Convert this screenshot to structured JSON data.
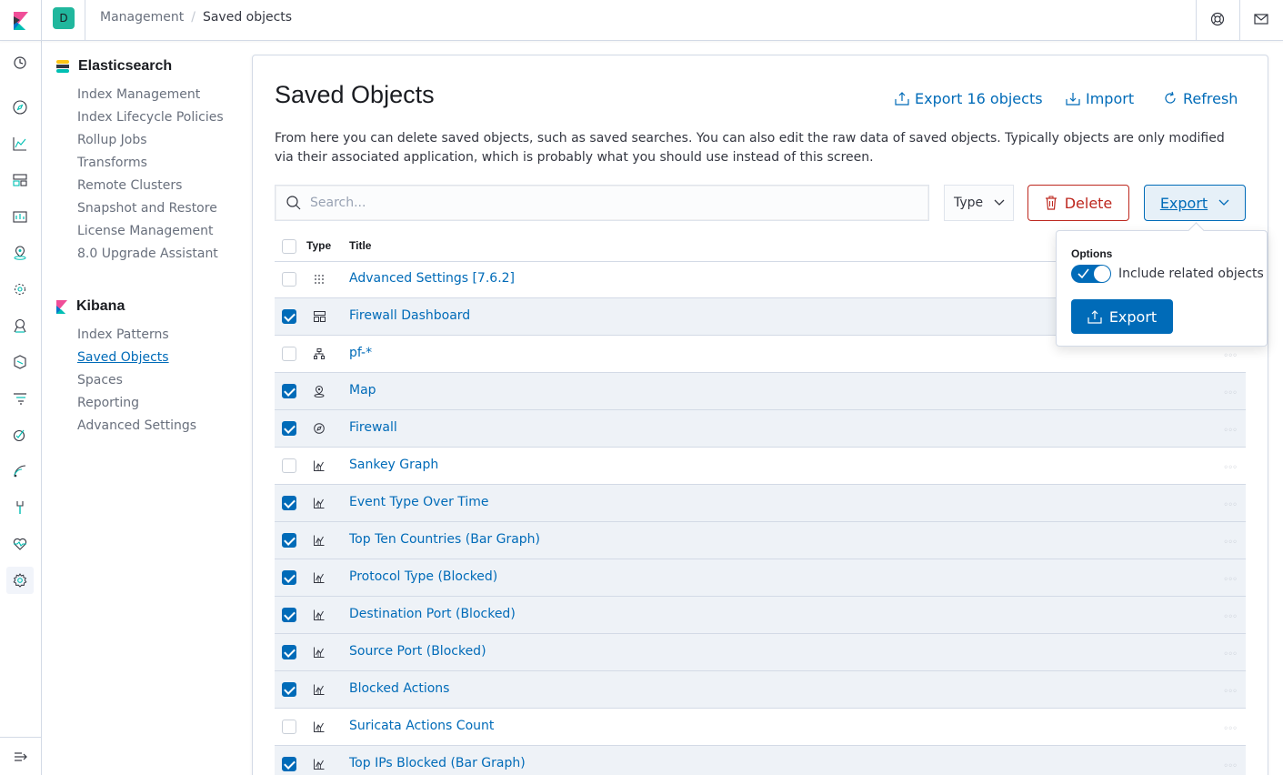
{
  "header": {
    "space_initial": "D",
    "breadcrumbs": [
      "Management",
      "Saved objects"
    ]
  },
  "sidenav": {
    "elasticsearch": {
      "title": "Elasticsearch",
      "items": [
        "Index Management",
        "Index Lifecycle Policies",
        "Rollup Jobs",
        "Transforms",
        "Remote Clusters",
        "Snapshot and Restore",
        "License Management",
        "8.0 Upgrade Assistant"
      ]
    },
    "kibana": {
      "title": "Kibana",
      "items": [
        "Index Patterns",
        "Saved Objects",
        "Spaces",
        "Reporting",
        "Advanced Settings"
      ],
      "selected": "Saved Objects"
    }
  },
  "main": {
    "title": "Saved Objects",
    "export_all_label": "Export 16 objects",
    "import_label": "Import",
    "refresh_label": "Refresh",
    "description": "From here you can delete saved objects, such as saved searches. You can also edit the raw data of saved objects. Typically objects are only modified via their associated application, which is probably what you should use instead of this screen.",
    "search_placeholder": "Search...",
    "type_filter_label": "Type",
    "delete_label": "Delete",
    "export_label": "Export",
    "columns": {
      "type": "Type",
      "title": "Title"
    },
    "rows": [
      {
        "title": "Advanced Settings [7.6.2]",
        "icon": "settings-grid-icon",
        "checked": false
      },
      {
        "title": "Firewall Dashboard",
        "icon": "dashboard-icon",
        "checked": true
      },
      {
        "title": "pf-*",
        "icon": "index-pattern-icon",
        "checked": false
      },
      {
        "title": "Map",
        "icon": "map-icon",
        "checked": true
      },
      {
        "title": "Firewall",
        "icon": "discover-icon",
        "checked": true
      },
      {
        "title": "Sankey Graph",
        "icon": "visualize-icon",
        "checked": false
      },
      {
        "title": "Event Type Over Time",
        "icon": "visualize-icon",
        "checked": true
      },
      {
        "title": "Top Ten Countries (Bar Graph)",
        "icon": "visualize-icon",
        "checked": true
      },
      {
        "title": "Protocol Type (Blocked)",
        "icon": "visualize-icon",
        "checked": true
      },
      {
        "title": "Destination Port (Blocked)",
        "icon": "visualize-icon",
        "checked": true
      },
      {
        "title": "Source Port (Blocked)",
        "icon": "visualize-icon",
        "checked": true
      },
      {
        "title": "Blocked Actions",
        "icon": "visualize-icon",
        "checked": true
      },
      {
        "title": "Suricata Actions Count",
        "icon": "visualize-icon",
        "checked": false
      },
      {
        "title": "Top IPs Blocked (Bar Graph)",
        "icon": "visualize-icon",
        "checked": true
      }
    ]
  },
  "popover": {
    "options_label": "Options",
    "include_related_label": "Include related objects",
    "include_related_on": true,
    "export_button_label": "Export"
  },
  "colors": {
    "accent": "#006bb8",
    "danger": "#bd271e",
    "space": "#20b79d"
  }
}
